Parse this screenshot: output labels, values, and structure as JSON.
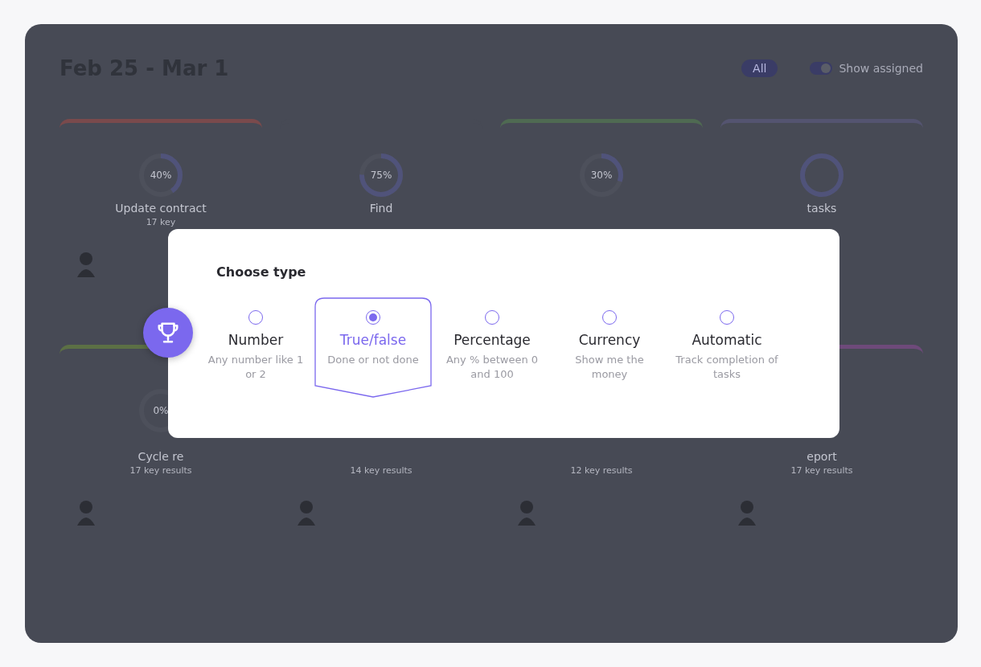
{
  "header": {
    "title": "Feb 25 - Mar 1",
    "filters": [
      {
        "label": "All",
        "selected": true
      }
    ],
    "toggle": {
      "label": "Show assigned",
      "on": true
    }
  },
  "rows": [
    [
      {
        "percent": "40%",
        "level": 0.4,
        "name": "Update contract",
        "key_results": "17 key",
        "color": "#7a4a4c",
        "avatar": true
      },
      {
        "percent": "75%",
        "level": 0.75,
        "name": "Find",
        "color": "#474a55"
      },
      {
        "percent": "30%",
        "level": 0.3,
        "color": "#4f6a52"
      },
      {
        "level": 1,
        "name": "tasks",
        "color": "#545470"
      }
    ],
    [
      {
        "percent": "0%",
        "name": "Cycle re",
        "key_results": "17 key results",
        "color": "#5c7045",
        "avatar": true
      },
      {
        "key_results": "14 key results",
        "color": "#474a55",
        "avatar": true
      },
      {
        "key_results": "12 key results",
        "color": "#474a55",
        "avatar": true
      },
      {
        "name": "eport",
        "key_results": "17 key results",
        "color": "#6e4a7a",
        "avatar": true
      }
    ]
  ],
  "dialog": {
    "title": "Choose type",
    "options": [
      {
        "label": "Number",
        "description": "Any number like 1 or 2",
        "selected": false
      },
      {
        "label": "True/false",
        "description": "Done or not done",
        "selected": true
      },
      {
        "label": "Percentage",
        "description": "Any % between 0 and 100",
        "selected": false
      },
      {
        "label": "Currency",
        "description": "Show me the money",
        "selected": false
      },
      {
        "label": "Automatic",
        "description": "Track completion of tasks",
        "selected": false
      }
    ]
  }
}
